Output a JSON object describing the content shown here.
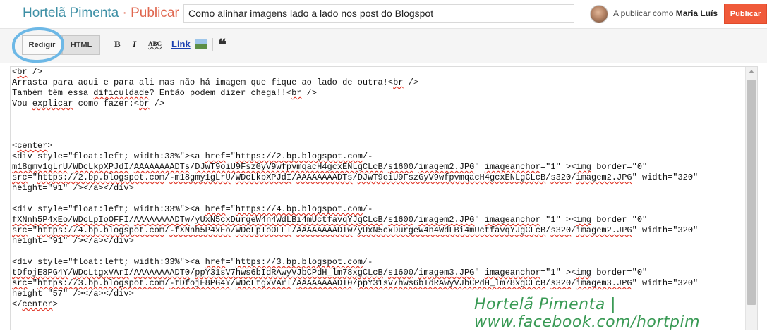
{
  "header": {
    "blog_name": "Hortelã Pimenta",
    "separator": " · ",
    "action": "Publicar",
    "post_title": "Como alinhar imagens lado a lado nos post do Blogspot",
    "publishing_as_label": "A publicar como",
    "user_name": "Maria Luís",
    "publish_label": "Publicar"
  },
  "toolbar": {
    "compose_label": "Redigir",
    "html_label": "HTML",
    "bold_label": "B",
    "italic_label": "I",
    "spell_label": "ABC",
    "link_label": "Link",
    "quote_label": "❝"
  },
  "editor": {
    "lines": [
      "<br />",
      "Arrasta para aqui e para ali mas não há imagem que fique ao lado de outra!<br />",
      "Também têm essa dificuldade? Então podem dizer chega!!<br />",
      "Vou explicar como fazer:<br />",
      "",
      "",
      "",
      "<center>",
      "<div style=\"float:left; width:33%\"><a href=\"https://2.bp.blogspot.com/-",
      "m18gmy1gLrU/WDcLkpXPJdI/AAAAAAAADTs/DJwT9oiU9FszGyV9wfpvmqacH4gcxENLgCLcB/s1600/imagem2.JPG\" imageanchor=\"1\" ><img border=\"0\"",
      "src=\"https://2.bp.blogspot.com/-m18gmy1gLrU/WDcLkpXPJdI/AAAAAAAADTs/DJwT9oiU9FszGyV9wfpvmqacH4gcxENLgCLcB/s320/imagem2.JPG\" width=\"320\"",
      "height=\"91\" /></a></div>",
      "",
      "<div style=\"float:left; width:33%\"><a href=\"https://4.bp.blogspot.com/-",
      "fXNnh5P4xEo/WDcLpIoOFFI/AAAAAAAADTw/yUxN5cxDurgeW4n4WdLBi4mUctfavqYJgCLcB/s1600/imagem2.JPG\" imageanchor=\"1\" ><img border=\"0\"",
      "src=\"https://4.bp.blogspot.com/-fXNnh5P4xEo/WDcLpIoOFFI/AAAAAAAADTw/yUxN5cxDurgeW4n4WdLBi4mUctfavqYJgCLcB/s320/imagem2.JPG\" width=\"320\"",
      "height=\"91\" /></a></div>",
      "",
      "<div style=\"float:left; width:33%\"><a href=\"https://3.bp.blogspot.com/-",
      "tDfojE8PG4Y/WDcLtgxVArI/AAAAAAAADT0/ppY31sV7hws6bIdRAwyVJbCPdH_lm78xgCLcB/s1600/imagem3.JPG\" imageanchor=\"1\" ><img border=\"0\"",
      "src=\"https://3.bp.blogspot.com/-tDfojE8PG4Y/WDcLtgxVArI/AAAAAAAADT0/ppY31sV7hws6bIdRAwyVJbCPdH_lm78xgCLcB/s320/imagem3.JPG\" width=\"320\"",
      "height=\"57\" /></a></div>",
      "</center>"
    ]
  },
  "watermark": "Hortelã Pimenta | www.facebook.com/hortpim",
  "colors": {
    "blog_name": "#3d8fa5",
    "accent": "#e0674f",
    "publish_button": "#f05a3a",
    "highlight_circle": "#6db8e6",
    "watermark": "#3a9a55"
  }
}
